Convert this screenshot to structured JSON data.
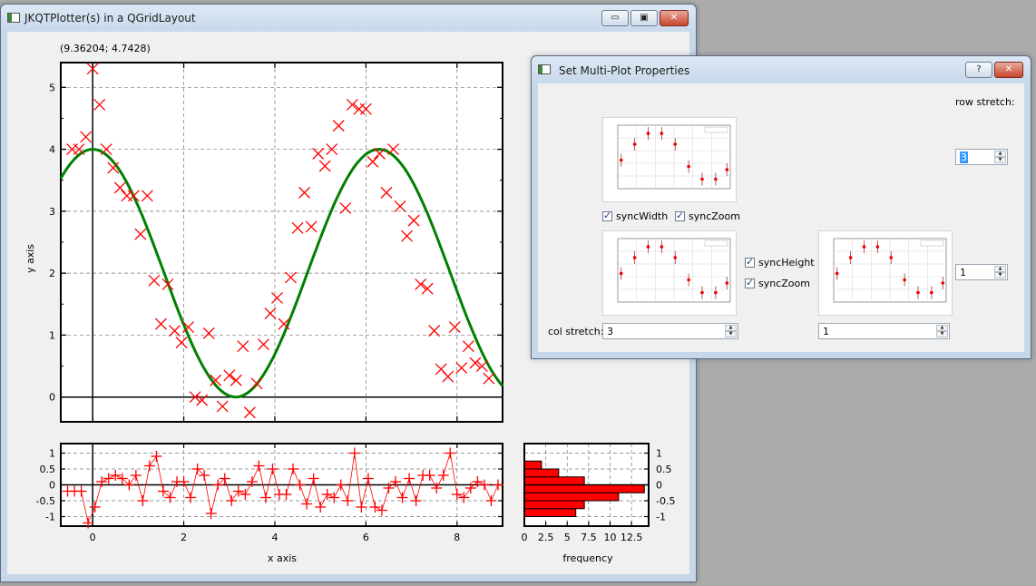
{
  "main_window": {
    "title": "JKQTPlotter(s) in a QGridLayout",
    "minimize_label": "▭",
    "maximize_label": "▣",
    "close_label": "✕",
    "cursor_readout": "(9.36204; 4.7428)",
    "main_plot": {
      "ylabel": "y axis",
      "x_range": [
        -0.7,
        9.0
      ],
      "y_range": [
        -0.4,
        5.4
      ],
      "y_ticks": [
        "0",
        "1",
        "2",
        "3",
        "4",
        "5"
      ],
      "x_ticks": [
        "0",
        "2",
        "4",
        "6",
        "8"
      ]
    },
    "residual_plot": {
      "xlabel": "x axis",
      "y_ticks": [
        "1",
        "0.5",
        "0",
        "-0.5",
        "-1"
      ],
      "x_ticks": [
        "0",
        "2",
        "4",
        "6",
        "8"
      ]
    },
    "histogram": {
      "xlabel": "frequency",
      "x_ticks": [
        "0",
        "2.5",
        "5",
        "7.5",
        "10",
        "12.5"
      ],
      "y_ticks": [
        "1",
        "0.5",
        "0",
        "-0.5",
        "-1"
      ]
    }
  },
  "dialog": {
    "title": "Set Multi-Plot Properties",
    "help_label": "?",
    "close_label": "✕",
    "row_stretch_label": "row stretch:",
    "col_stretch_label": "col stretch:",
    "row_stretch_top": "3",
    "row_stretch_bottom": "1",
    "col_stretch_left": "3",
    "col_stretch_right": "1",
    "sync_width_label": "syncWidth",
    "sync_zoom_label_1": "syncZoom",
    "sync_height_label": "syncHeight",
    "sync_zoom_label_2": "syncZoom"
  },
  "chart_data": [
    {
      "type": "scatter",
      "title": "",
      "xlabel": "",
      "ylabel": "y axis",
      "xlim": [
        -0.7,
        9.0
      ],
      "ylim": [
        -0.4,
        5.4
      ],
      "grid": true,
      "series": [
        {
          "style": "x-markers",
          "color": "#ff0000",
          "x": [
            -0.45,
            -0.3,
            -0.15,
            0.0,
            0.15,
            0.3,
            0.45,
            0.6,
            0.75,
            0.9,
            1.05,
            1.2,
            1.35,
            1.5,
            1.65,
            1.8,
            1.95,
            2.1,
            2.25,
            2.4,
            2.55,
            2.7,
            2.85,
            3.0,
            3.15,
            3.3,
            3.45,
            3.6,
            3.75,
            3.9,
            4.05,
            4.2,
            4.35,
            4.5,
            4.65,
            4.8,
            4.95,
            5.1,
            5.25,
            5.4,
            5.55,
            5.7,
            5.85,
            6.0,
            6.15,
            6.3,
            6.45,
            6.6,
            6.75,
            6.9,
            7.05,
            7.2,
            7.35,
            7.5,
            7.65,
            7.8,
            7.95,
            8.1,
            8.25,
            8.4,
            8.55,
            8.7
          ],
          "y": [
            4.0,
            4.0,
            4.2,
            5.3,
            4.72,
            4.0,
            3.7,
            3.38,
            3.25,
            3.25,
            2.63,
            3.25,
            1.88,
            1.18,
            1.82,
            1.07,
            0.88,
            1.13,
            0.0,
            -0.05,
            1.03,
            0.27,
            -0.15,
            0.35,
            0.27,
            0.82,
            -0.25,
            0.22,
            0.85,
            1.35,
            1.6,
            1.18,
            1.93,
            2.73,
            3.3,
            2.75,
            3.93,
            3.73,
            4.0,
            4.38,
            3.05,
            4.72,
            4.65,
            4.65,
            3.8,
            3.93,
            3.3,
            4.0,
            3.08,
            2.6,
            2.85,
            1.82,
            1.75,
            1.07,
            0.45,
            0.33,
            1.13,
            0.47,
            0.82,
            0.55,
            0.5,
            0.3
          ]
        },
        {
          "style": "line",
          "color": "#008000",
          "function": "2*cos(x)+2",
          "x_step": 0.1
        }
      ]
    },
    {
      "type": "line",
      "xlabel": "x axis",
      "ylabel": "",
      "xlim": [
        -0.7,
        9.0
      ],
      "ylim": [
        -1.3,
        1.3
      ],
      "grid": true,
      "series": [
        {
          "style": "line+plus-markers",
          "color": "#ff0000",
          "x": [
            -0.55,
            -0.4,
            -0.25,
            -0.1,
            0.05,
            0.2,
            0.35,
            0.5,
            0.65,
            0.8,
            0.95,
            1.1,
            1.25,
            1.4,
            1.55,
            1.7,
            1.85,
            2.0,
            2.15,
            2.3,
            2.45,
            2.6,
            2.75,
            2.9,
            3.05,
            3.2,
            3.35,
            3.5,
            3.65,
            3.8,
            3.95,
            4.1,
            4.25,
            4.4,
            4.55,
            4.7,
            4.85,
            5.0,
            5.15,
            5.3,
            5.45,
            5.6,
            5.75,
            5.9,
            6.05,
            6.2,
            6.35,
            6.5,
            6.65,
            6.8,
            6.95,
            7.1,
            7.25,
            7.4,
            7.55,
            7.7,
            7.85,
            8.0,
            8.15,
            8.3,
            8.45,
            8.6,
            8.75,
            8.9
          ],
          "y": [
            -0.2,
            -0.2,
            -0.2,
            -1.2,
            -0.7,
            0.1,
            0.2,
            0.3,
            0.2,
            0.0,
            0.3,
            -0.5,
            0.6,
            0.9,
            -0.2,
            -0.4,
            0.1,
            0.1,
            -0.4,
            0.5,
            0.3,
            -0.9,
            0.0,
            0.2,
            -0.5,
            -0.2,
            -0.3,
            0.1,
            0.6,
            -0.4,
            0.5,
            -0.3,
            -0.3,
            0.5,
            0.0,
            -0.6,
            0.2,
            -0.7,
            -0.3,
            -0.4,
            0.0,
            -0.5,
            1.0,
            -0.7,
            0.2,
            -0.7,
            -0.8,
            -0.1,
            0.1,
            -0.4,
            0.2,
            -0.5,
            0.3,
            0.3,
            -0.1,
            0.3,
            1.0,
            -0.3,
            -0.4,
            -0.1,
            0.1,
            0.0,
            -0.5,
            0.0
          ]
        }
      ]
    },
    {
      "type": "bar",
      "orientation": "horizontal",
      "xlabel": "frequency",
      "xlim": [
        0,
        14.5
      ],
      "ylim": [
        -1.3,
        1.3
      ],
      "color": "#ff0000",
      "bins": [
        -1.0,
        -0.75,
        -0.5,
        -0.25,
        0.0,
        0.25,
        0.5,
        0.75,
        1.0
      ],
      "values": [
        6,
        7,
        11,
        14,
        7,
        4,
        2
      ]
    }
  ]
}
